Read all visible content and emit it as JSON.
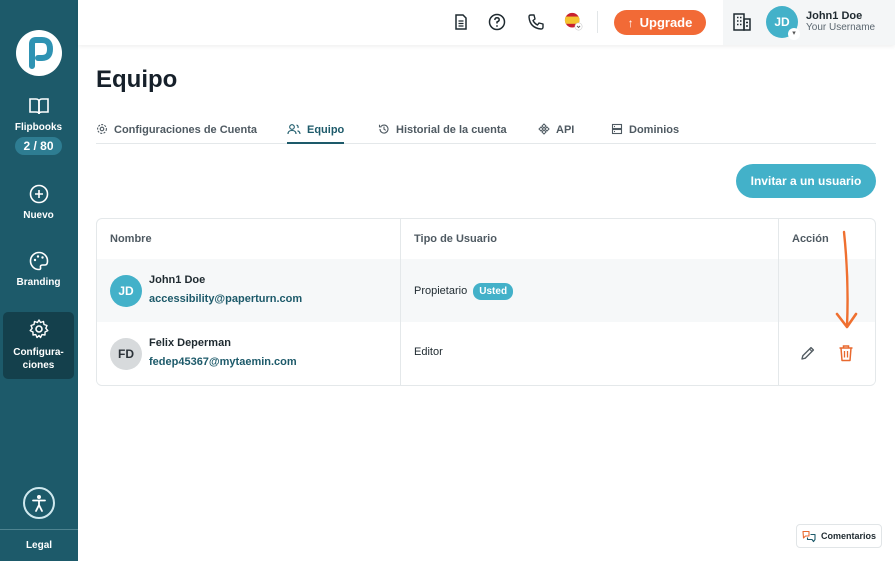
{
  "sidebar": {
    "logo_icon": "paperturn-logo",
    "items": [
      {
        "label": "Flipbooks",
        "icon": "book-icon",
        "count": "2 / 80"
      },
      {
        "label": "Nuevo",
        "icon": "plus-circle-icon"
      },
      {
        "label": "Branding",
        "icon": "palette-icon"
      },
      {
        "label": "Configura-\nciones",
        "icon": "gear-icon",
        "active": true
      }
    ],
    "accessibility_icon": "accessibility-icon",
    "legal": "Legal"
  },
  "topbar": {
    "icons": [
      "document-icon",
      "help-icon",
      "phone-icon",
      "spain-flag-icon"
    ],
    "upgrade_label": "Upgrade",
    "building_icon": "building-icon",
    "avatar_initials": "JD",
    "user_name": "John1 Doe",
    "user_sub": "Your Username"
  },
  "page": {
    "title": "Equipo",
    "tabs": [
      {
        "label": "Configuraciones de Cuenta",
        "icon": "gear-icon"
      },
      {
        "label": "Equipo",
        "icon": "users-icon",
        "active": true
      },
      {
        "label": "Historial de la cuenta",
        "icon": "history-icon"
      },
      {
        "label": "API",
        "icon": "api-icon"
      },
      {
        "label": "Dominios",
        "icon": "server-icon"
      }
    ],
    "invite_label": "Invitar a un usuario"
  },
  "table": {
    "headers": {
      "name": "Nombre",
      "type": "Tipo de Usuario",
      "action": "Acción"
    },
    "rows": [
      {
        "initials": "JD",
        "name": "John1 Doe",
        "email": "accessibility@paperturn.com",
        "role": "Propietario",
        "badge": "Usted"
      },
      {
        "initials": "FD",
        "name": "Felix Deperman",
        "email": "fedep45367@mytaemin.com",
        "role": "Editor",
        "actions": [
          "edit-icon",
          "trash-icon"
        ]
      }
    ]
  },
  "feedback_label": "Comentarios",
  "colors": {
    "sidebar": "#1d5a6a",
    "accent": "#43b1c9",
    "upgrade": "#f26a36",
    "delete": "#e8692f"
  }
}
